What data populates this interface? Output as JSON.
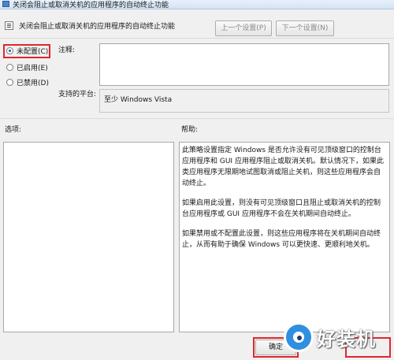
{
  "window": {
    "title": "关闭会阻止或取消关机的应用程序的自动终止功能"
  },
  "header": {
    "setting_name": "关闭会阻止或取消关机的应用程序的自动终止功能",
    "prev_button": "上一个设置(P)",
    "next_button": "下一个设置(N)"
  },
  "state_options": [
    {
      "label": "未配置(C)",
      "selected": true
    },
    {
      "label": "已启用(E)",
      "selected": false
    },
    {
      "label": "已禁用(D)",
      "selected": false
    }
  ],
  "comment": {
    "label": "注释:",
    "value": ""
  },
  "platform": {
    "label": "支持的平台:",
    "value": "至少 Windows Vista"
  },
  "options": {
    "label": "选项:"
  },
  "help": {
    "label": "帮助:",
    "paragraphs": [
      "此策略设置指定 Windows 是否允许没有可见顶级窗口的控制台应用程序和 GUI 应用程序阻止或取消关机。默认情况下，如果此类应用程序无限期地试图取消或阻止关机，则这些应用程序会自动终止。",
      "如果启用此设置，则没有可见顶级窗口且阻止或取消关机的控制台应用程序或 GUI 应用程序不会在关机期间自动终止。",
      "如果禁用或不配置此设置，则这些应用程序将在关机期间自动终止，从而有助于确保 Windows 可以更快速、更顺利地关机。"
    ]
  },
  "footer": {
    "ok_button": "确定"
  },
  "watermark": {
    "text": "好装机"
  },
  "colors": {
    "highlight": "#e0262d",
    "watermark_blue": "#2f8fe0"
  }
}
